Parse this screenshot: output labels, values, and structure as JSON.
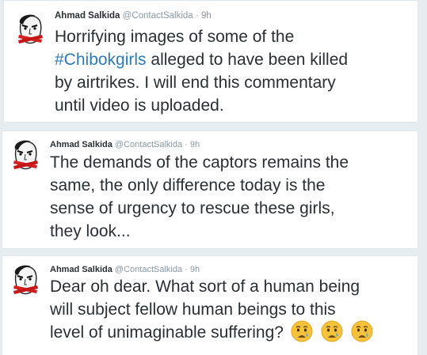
{
  "tweets": [
    {
      "name": "Ahmad Salkida",
      "handle": "@ContactSalkida",
      "separator": "·",
      "time": "9h",
      "lines": [
        [
          "Horrifying images of some of the"
        ],
        [
          "#Chibokgirls",
          " alleged to have been killed"
        ],
        [
          "by airtrikes. I will end this commentary"
        ],
        [
          "until video is uploaded."
        ]
      ]
    },
    {
      "name": "Ahmad Salkida",
      "handle": "@ContactSalkida",
      "separator": "·",
      "time": "9h",
      "lines": [
        "The demands of the captors remains the",
        "same, the only difference today is the",
        "sense of urgency to rescue these girls,",
        "they look..."
      ]
    },
    {
      "name": "Ahmad Salkida",
      "handle": "@ContactSalkida",
      "separator": "·",
      "time": "9h",
      "lines": [
        "Dear oh dear. What sort of a human being",
        "will subject fellow human beings to this",
        "level of unimaginable suffering?"
      ],
      "emojis": [
        "crying-face-emoji",
        "crying-face-emoji",
        "crying-face-emoji"
      ]
    }
  ],
  "colors": {
    "text": "#292f33",
    "muted": "#8899a6",
    "hashtag": "#2b7bb9",
    "background": "#e6ecf0",
    "card": "#ffffff",
    "emoji": "#f5c33b",
    "tear": "#5dadec"
  }
}
